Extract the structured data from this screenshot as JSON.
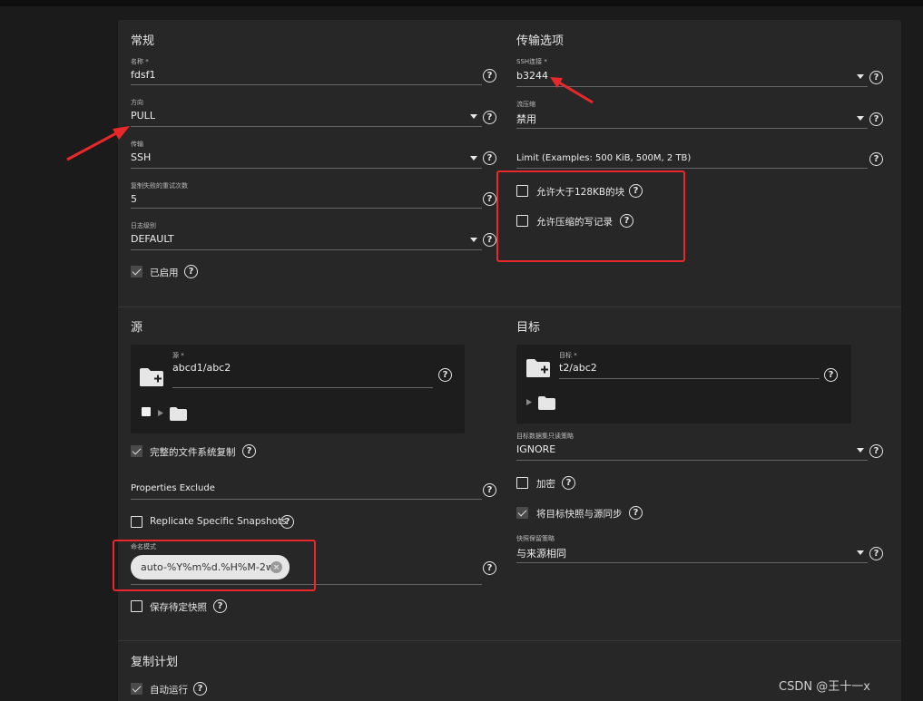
{
  "general": {
    "title": "常规",
    "name": {
      "label": "名称 *",
      "value": "fdsf1"
    },
    "direction": {
      "label": "方向",
      "value": "PULL"
    },
    "transport": {
      "label": "传输",
      "value": "SSH"
    },
    "retries": {
      "label": "复制失败的重试次数",
      "value": "5"
    },
    "log_level": {
      "label": "日志级别",
      "value": "DEFAULT"
    },
    "enabled": {
      "label": "已启用",
      "checked": true
    }
  },
  "transport_options": {
    "title": "传输选项",
    "ssh": {
      "label": "SSH连接 *",
      "value": "b3244"
    },
    "compression": {
      "label": "流压缩",
      "value": "禁用"
    },
    "limit": {
      "label": "Limit (Examples: 500 KiB, 500M, 2 TB)"
    },
    "large_block": {
      "label": "允许大于128KB的块",
      "checked": false
    },
    "compressed_write": {
      "label": "允许压缩的写记录",
      "checked": false
    }
  },
  "source": {
    "title": "源",
    "field": {
      "label": "源 *",
      "value": "abcd1/abc2"
    },
    "full_fs": {
      "label": "完整的文件系统复制",
      "checked": true
    },
    "props_exclude": {
      "label": "Properties Exclude"
    },
    "replicate_specific": {
      "label": "Replicate Specific Snapshots",
      "checked": false
    },
    "naming_schema": {
      "label": "命名模式",
      "chip": "auto-%Y%m%d.%H%M-2w"
    },
    "save_pending": {
      "label": "保存待定快照",
      "checked": false
    }
  },
  "target": {
    "title": "目标",
    "field": {
      "label": "目标 *",
      "value": "t2/abc2"
    },
    "readonly_policy": {
      "label": "目标数据集只读策略",
      "value": "IGNORE"
    },
    "encryption": {
      "label": "加密",
      "checked": false
    },
    "sync_snapshots": {
      "label": "将目标快照与源同步",
      "checked": true
    },
    "retention": {
      "label": "快照保留策略",
      "value": "与来源相同"
    }
  },
  "schedule": {
    "title": "复制计划",
    "auto_run": {
      "label": "自动运行",
      "checked": true
    }
  },
  "icons": {
    "help": "?",
    "clear": "×"
  },
  "colors": {
    "annotation_red": "#e8282a",
    "card": "#272727",
    "background": "#1b1b1b"
  },
  "watermark": "CSDN @王十一x"
}
